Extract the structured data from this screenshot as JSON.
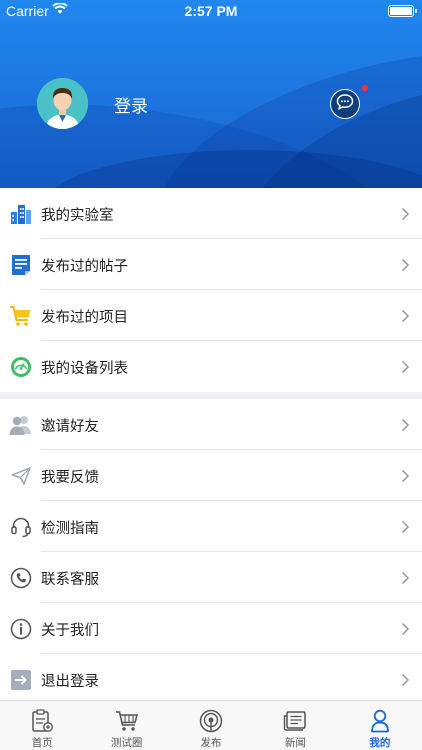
{
  "status_bar": {
    "carrier": "Carrier",
    "time": "2:57 PM"
  },
  "header": {
    "login_label": "登录",
    "has_unread_message": true
  },
  "menu_group_1": [
    {
      "label": "我的实验室",
      "icon": "lab-building-icon"
    },
    {
      "label": "发布过的帖子",
      "icon": "posts-document-icon"
    },
    {
      "label": "发布过的项目",
      "icon": "shopping-cart-icon"
    },
    {
      "label": "我的设备列表",
      "icon": "device-gauge-icon"
    }
  ],
  "menu_group_2": [
    {
      "label": "邀请好友",
      "icon": "invite-friends-icon"
    },
    {
      "label": "我要反馈",
      "icon": "feedback-paper-plane-icon"
    },
    {
      "label": "检测指南",
      "icon": "headset-icon"
    },
    {
      "label": "联系客服",
      "icon": "phone-icon"
    },
    {
      "label": "关于我们",
      "icon": "info-icon"
    },
    {
      "label": "退出登录",
      "icon": "logout-arrow-icon"
    }
  ],
  "tab_bar": {
    "tabs": [
      {
        "label": "首页",
        "icon": "home-clipboard-icon"
      },
      {
        "label": "测试圈",
        "icon": "test-circle-cart-icon"
      },
      {
        "label": "发布",
        "icon": "publish-broadcast-icon"
      },
      {
        "label": "新闻",
        "icon": "news-icon"
      },
      {
        "label": "我的",
        "icon": "profile-person-icon",
        "active": true
      }
    ]
  },
  "colors": {
    "accent": "#1a68e0",
    "header": "#1e78e2",
    "badge": "#ff3030"
  }
}
